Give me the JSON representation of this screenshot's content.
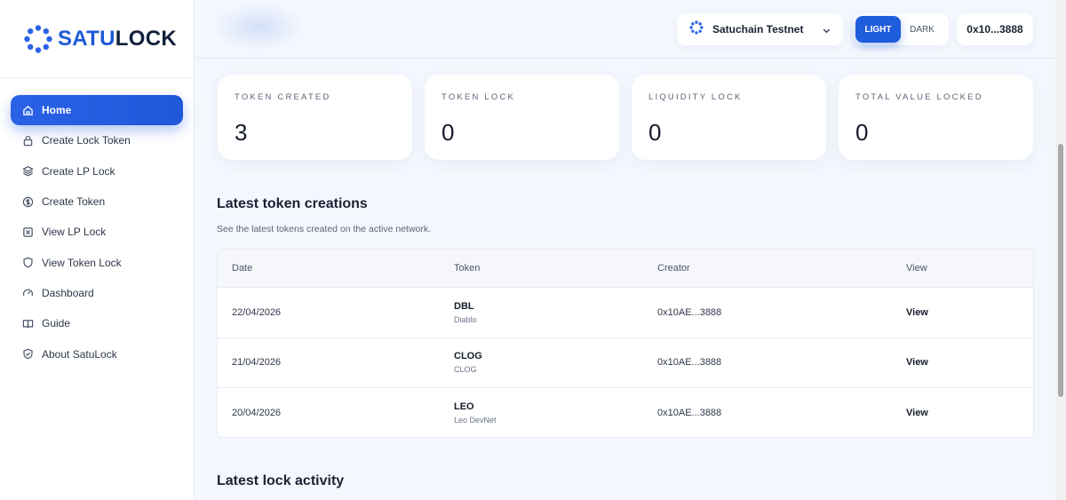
{
  "brand": {
    "name_part1": "SATU",
    "name_part2": "LOCK"
  },
  "sidebar": {
    "items": [
      {
        "label": "Home",
        "icon": "home-icon",
        "active": true
      },
      {
        "label": "Create Lock Token",
        "icon": "lock-icon"
      },
      {
        "label": "Create LP Lock",
        "icon": "layers-icon"
      },
      {
        "label": "Create Token",
        "icon": "coin-icon"
      },
      {
        "label": "View LP Lock",
        "icon": "square-x-icon"
      },
      {
        "label": "View Token Lock",
        "icon": "shield-icon"
      },
      {
        "label": "Dashboard",
        "icon": "gauge-icon"
      },
      {
        "label": "Guide",
        "icon": "book-icon"
      },
      {
        "label": "About SatuLock",
        "icon": "shield-check-icon"
      }
    ]
  },
  "header": {
    "network": "Satuchain Testnet",
    "theme": {
      "light": "LIGHT",
      "dark": "DARK",
      "selected": "LIGHT"
    },
    "wallet": "0x10...3888"
  },
  "stats": [
    {
      "label": "TOKEN CREATED",
      "value": "3"
    },
    {
      "label": "TOKEN LOCK",
      "value": "0"
    },
    {
      "label": "LIQUIDITY LOCK",
      "value": "0"
    },
    {
      "label": "TOTAL VALUE LOCKED",
      "value": "0"
    }
  ],
  "latest_tokens": {
    "title": "Latest token creations",
    "subtitle": "See the latest tokens created on the active network.",
    "columns": [
      "Date",
      "Token",
      "Creator",
      "View"
    ],
    "rows": [
      {
        "date": "22/04/2026",
        "symbol": "DBL",
        "name": "Diablo",
        "creator": "0x10AE...3888",
        "view": "View"
      },
      {
        "date": "21/04/2026",
        "symbol": "CLOG",
        "name": "CLOG",
        "creator": "0x10AE...3888",
        "view": "View"
      },
      {
        "date": "20/04/2026",
        "symbol": "LEO",
        "name": "Leo DevNet",
        "creator": "0x10AE...3888",
        "view": "View"
      }
    ]
  },
  "latest_lock": {
    "title": "Latest lock activity"
  },
  "colors": {
    "accent": "#1f5ddc",
    "background": "#f4f7fd",
    "card": "#ffffff"
  }
}
